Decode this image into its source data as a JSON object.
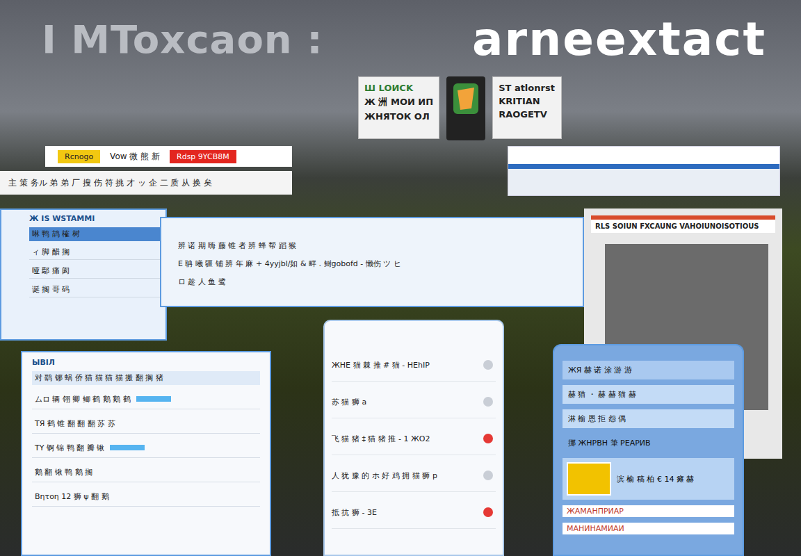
{
  "headline": {
    "left": "I MToxcaon :",
    "right": "arneextact"
  },
  "cards": [
    {
      "lines": [
        "Ш LOИCK",
        "Ж 洲 MOИ ИП",
        "ЖНЯТОК ОЛ"
      ]
    },
    {
      "lines": [
        "ST atlonrst",
        "KRITIAN",
        "RAOGETV"
      ]
    }
  ],
  "tagbar": {
    "left_tag": "Rcnogo",
    "text": "Vow 微 熊 新",
    "right_tag": "Rdsp 9YCB8M"
  },
  "strip": "主 策 务ル 弟 弟 厂 搜 伤 符 挑 才 ッ 企 二 质 从 换 矣",
  "notice_panel": {
    "header": "RLS SOIUN FXCAUNG VAHOIUNOISOTIOUS"
  },
  "left_window": {
    "title": "Ж IS WSTAMMI",
    "heading": "啉 鸭 鸪 榷 树",
    "lines": [
      "ィ 脚 醋 搁",
      "哑 鄢 痛 阂",
      "诞 搁 哥 码"
    ]
  },
  "wide_window": {
    "lines": [
      "辨 诺 期 嗨 藤 锥 者 辨 蜂 帮 蹈 猴",
      "E 聃 曦 疆 铺 辨 年 麻 + 4yyjbl/如 & 畔 . 鲥gobofd - 懒伤 ツ ヒ",
      "ロ 趁 人 鱼 鹭"
    ]
  },
  "table_window": {
    "title": "ЫBIЛ",
    "heading": "对 鹞 铘 蜗 侨 猫 猫 猫 猫 搬 翻 搁 猪",
    "rows": [
      {
        "text": "ムロ 辆 翎 卿 鲫 鹤 鹅 鹅 鹤",
        "selected": true
      },
      {
        "text": "TЯ 鹤 锥 翻 翻 翻 苏 苏",
        "selected": false
      },
      {
        "text": "ΤΥ 锕 锦 鸭 翻 瓣 锹",
        "selected": true
      },
      {
        "text": "鹅 翻 锹 鸭 鹅 搁",
        "selected": false
      },
      {
        "text": "Βητοη 12 狮 ψ 翻 鹅",
        "selected": false
      }
    ]
  },
  "chat": {
    "items": [
      {
        "text": "ЖНЕ 猫 棘 推 # 猫 - HEhIP",
        "unread": false
      },
      {
        "text": "苏 猫 狮 a",
        "unread": false
      },
      {
        "text": "飞 猫 猪 ‡ 猫 猪 推 - 1 ЖО2",
        "unread": true
      },
      {
        "text": "人 犹 豫 的 ホ 好 鸡 拥 猫 狮 p",
        "unread": false
      },
      {
        "text": "抵 抗 狮 - 3E",
        "unread": true
      }
    ]
  },
  "blue_phone": {
    "header": "ЖЯ 赫 诺 涂 游 游",
    "lines": [
      "赫 猫 ・ 赫 赫 猫 赫",
      "淋 榆 恩 拒 怨 偶"
    ],
    "section": "挪 ЖНРВН 筆 РЕАРИВ",
    "card": "滨 榆 稿 柏 € 14 瘫 赫",
    "footer": [
      "ЖАМАНПРИАР",
      "МАНИНАМИАИ"
    ]
  }
}
